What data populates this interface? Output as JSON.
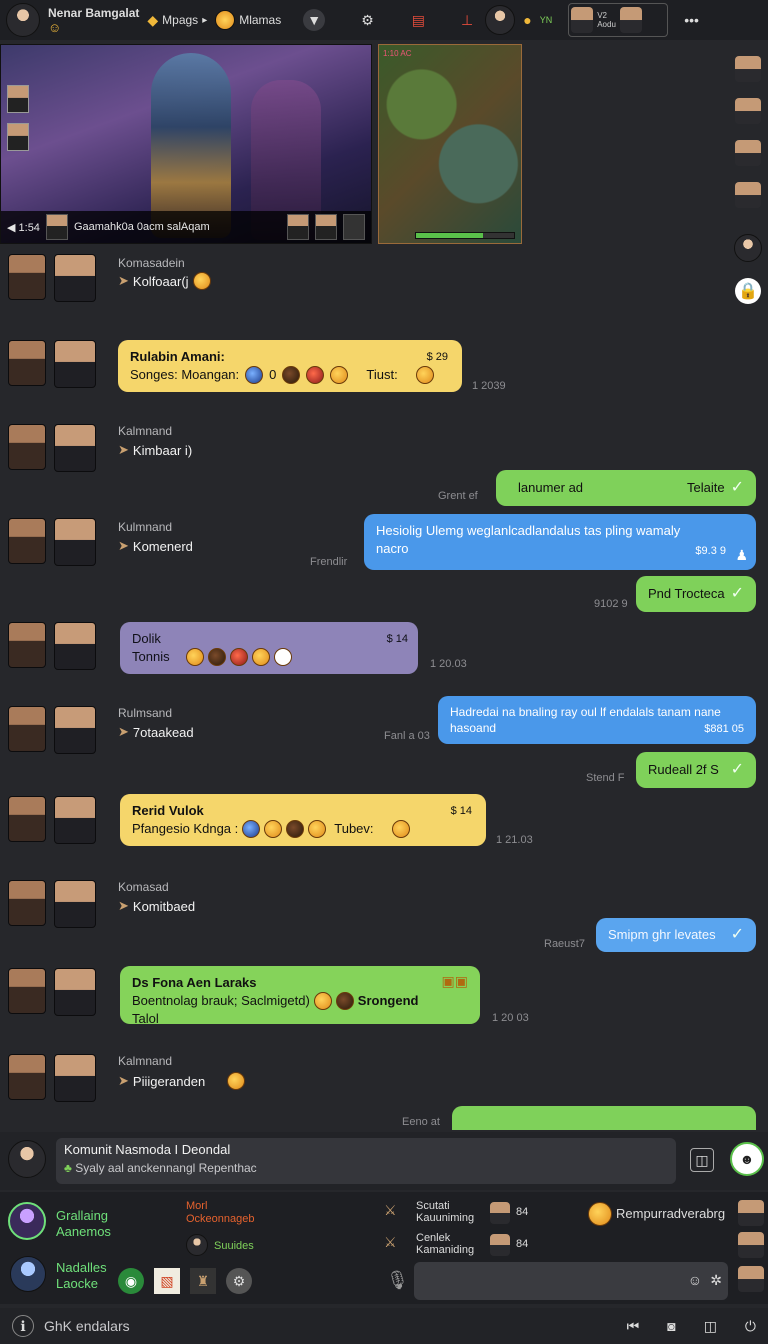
{
  "topbar": {
    "title": "Nenar Bamgalat",
    "nav1": "Mpags",
    "nav2": "Mlamas",
    "stat": "V2\nAodu"
  },
  "stream": {
    "caption": "Gaamahk0a 0acm salAqam",
    "counter": "◀ 1:54",
    "minimap_hp": 0.68,
    "map_label": "1:10 AC"
  },
  "messages": [
    {
      "sender": "Komasadein",
      "text": "Kolfoaar(j"
    },
    {
      "bubble_title": "Rulabin Amani:",
      "bubble_text": "Songes: Moangan:",
      "meta": "$ 29",
      "extra": "0",
      "extra2": "Tiust:",
      "time": "1 2039"
    },
    {
      "sender": "Kalmnand",
      "text": "Kimbaar i)"
    },
    {
      "out": "lanumer ad",
      "out_meta": "Telaite",
      "left_time": "Grent ef"
    },
    {
      "sender": "Kulmnand",
      "text": "Komenerd"
    },
    {
      "out": "Hesiolig Ulemg weglanlcadlandalus tas pling wamaly nacro",
      "out_meta": "$9.3 9",
      "left_time": "Frendlir"
    },
    {
      "out": "Pnd Trocteca",
      "left_time": "9102 9"
    },
    {
      "bubble_title": "Dolik",
      "bubble_text": "Tonnis",
      "meta": "$ 14",
      "time": "1 20.03"
    },
    {
      "sender": "Rulmsand",
      "text": "7otaakead"
    },
    {
      "out": "Hadredai na bnaling ray oul lf endalals tanam nane hasoand",
      "out_meta": "$881 05",
      "left_time": "Fanl a 03"
    },
    {
      "out": "Rudeall 2f S",
      "left_time": "Stend F"
    },
    {
      "bubble_title": "Rerid Vulok",
      "bubble_text": "Pfangesio Kdnga :",
      "meta": "$ 14",
      "extra2": "Tubev:",
      "time": "1 21.03"
    },
    {
      "sender": "Komasad",
      "text": "Komitbaed"
    },
    {
      "out": "Smipm ghr levates",
      "left_time": "Raeust7"
    },
    {
      "bubble_title": "Ds Fona Aen Laraks",
      "bubble_text": "Boentnolag brauk; Saclmigetd)",
      "bubble_text2": "Talol",
      "extra2": "Srongend",
      "time": "1 20 03"
    },
    {
      "sender": "Kalmnand",
      "text": "Piiigeranden"
    },
    {
      "left_time": "Eeno at"
    }
  ],
  "input": {
    "line1": "Komunit Nasmoda I Deondal",
    "line2": "Syaly aal anckennangl Repenthac"
  },
  "bottom": {
    "g1a": "Grallaing",
    "g1b": "Aanemos",
    "g2a": "Nadalles",
    "g2b": "Laocke",
    "mid1a": "Morl",
    "mid1b": "Ockeonnageb",
    "mid2": "Suuides",
    "c1a": "Scutati",
    "c1b": "Kauuniming",
    "c1v": "84",
    "c2a": "Cenlek",
    "c2b": "Kamaniding",
    "c2v": "84",
    "promo": "Rempurradverabrg"
  },
  "footer": {
    "text": "GhK endalars"
  }
}
